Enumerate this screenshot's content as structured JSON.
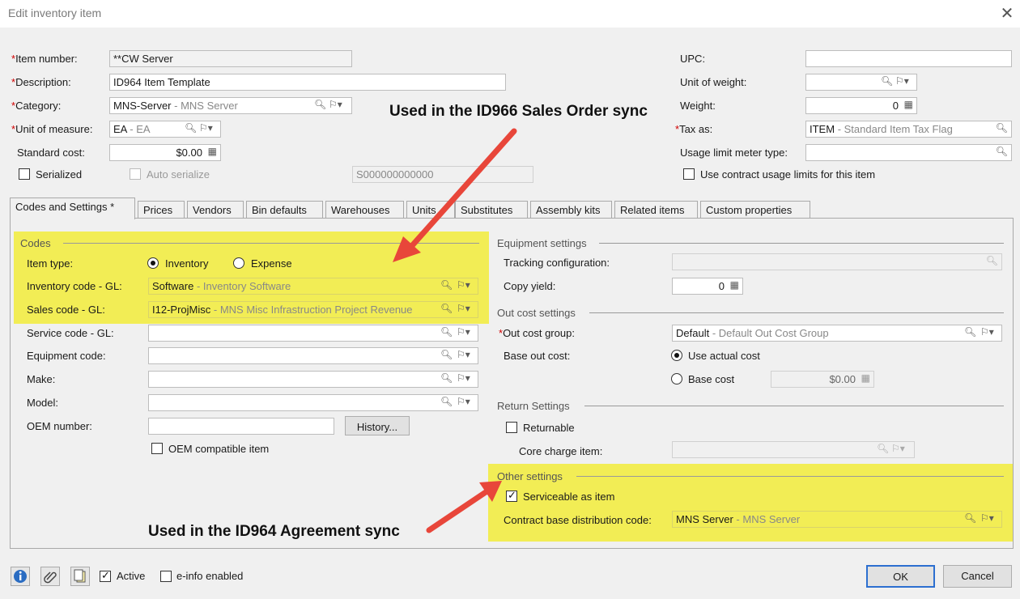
{
  "window": {
    "title": "Edit inventory item",
    "close": "✕"
  },
  "header": {
    "item_number_label": "Item number:",
    "item_number": "**CW Server",
    "description_label": "Description:",
    "description": "ID964 Item Template",
    "category_label": "Category:",
    "category_code": "MNS-Server",
    "category_desc": "- MNS Server",
    "uom_label": "Unit of measure:",
    "uom_code": "EA",
    "uom_desc": "- EA",
    "standard_cost_label": "Standard cost:",
    "standard_cost": "$0.00",
    "serialized_label": "Serialized",
    "auto_serialize_label": "Auto serialize",
    "serial_mask": "S000000000000",
    "upc_label": "UPC:",
    "upc": "",
    "unit_of_weight_label": "Unit of weight:",
    "unit_of_weight": "",
    "weight_label": "Weight:",
    "weight": "0",
    "tax_as_label": "Tax as:",
    "tax_as_code": "ITEM",
    "tax_as_desc": "- Standard Item Tax Flag",
    "usage_limit_label": "Usage limit meter type:",
    "usage_limit": "",
    "use_contract_label": "Use contract usage limits for this item"
  },
  "tabs": [
    {
      "label": "Codes and Settings *"
    },
    {
      "label": "Prices"
    },
    {
      "label": "Vendors"
    },
    {
      "label": "Bin defaults"
    },
    {
      "label": "Warehouses"
    },
    {
      "label": "Units"
    },
    {
      "label": "Substitutes"
    },
    {
      "label": "Assembly kits"
    },
    {
      "label": "Related items"
    },
    {
      "label": "Custom properties"
    }
  ],
  "codes": {
    "section": "Codes",
    "item_type_label": "Item type:",
    "inventory": "Inventory",
    "expense": "Expense",
    "inventory_gl_label": "Inventory code - GL:",
    "inventory_gl_code": "Software",
    "inventory_gl_desc": "- Inventory Software",
    "sales_gl_label": "Sales code - GL:",
    "sales_gl_code": "I12-ProjMisc",
    "sales_gl_desc": "- MNS Misc Infrastruction Project Revenue",
    "service_gl_label": "Service code - GL:",
    "equipment_code_label": "Equipment code:",
    "make_label": "Make:",
    "model_label": "Model:",
    "oem_label": "OEM number:",
    "oem_value": "",
    "history_button": "History...",
    "oem_compat_label": "OEM compatible item"
  },
  "equipment": {
    "section": "Equipment settings",
    "tracking_label": "Tracking configuration:",
    "copy_yield_label": "Copy yield:",
    "copy_yield": "0"
  },
  "outcost": {
    "section": "Out cost settings",
    "group_label": "Out cost group:",
    "group_code": "Default",
    "group_desc": "- Default Out Cost Group",
    "base_label": "Base out cost:",
    "use_actual": "Use actual cost",
    "base_cost": "Base cost",
    "base_cost_value": "$0.00"
  },
  "returns": {
    "section": "Return Settings",
    "returnable": "Returnable",
    "core_label": "Core charge item:"
  },
  "other": {
    "section": "Other settings",
    "serviceable": "Serviceable as item",
    "contract_label": "Contract base distribution code:",
    "contract_code": "MNS Server",
    "contract_desc": "- MNS Server"
  },
  "annotations": {
    "sales_order": "Used in the ID966 Sales Order sync",
    "agreement": "Used in the ID964 Agreement sync"
  },
  "footer": {
    "active": "Active",
    "einfo": "e-info enabled",
    "ok": "OK",
    "cancel": "Cancel"
  },
  "colors": {
    "highlight": "#f2ed55",
    "arrow": "#e8463a",
    "required": "#d00000",
    "ok_border": "#2c6fd0"
  }
}
